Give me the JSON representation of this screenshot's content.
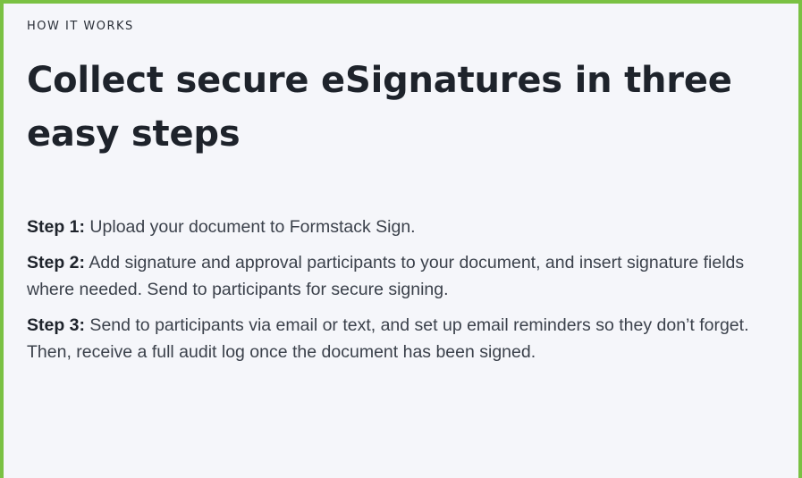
{
  "section": {
    "eyebrow": "HOW IT WORKS",
    "title": "Collect secure eSignatures in three easy steps"
  },
  "steps": [
    {
      "label": "Step 1:",
      "text": " Upload your document to Formstack Sign."
    },
    {
      "label": "Step 2:",
      "text": " Add signature and approval participants to your document, and insert signature fields where needed. Send to participants for secure signing."
    },
    {
      "label": "Step 3:",
      "text": " Send to participants via email or text, and set up email reminders so they don’t forget. Then, receive a full audit log once the document has been signed."
    }
  ],
  "colors": {
    "accent_border": "#7ac143",
    "background": "#f5f6fa",
    "heading": "#1e232b",
    "body_text": "#3b414b"
  }
}
